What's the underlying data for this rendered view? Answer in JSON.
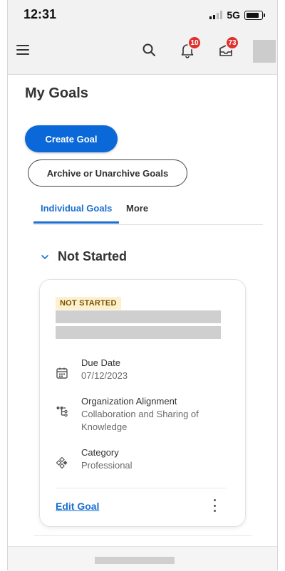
{
  "status_bar": {
    "time": "12:31",
    "network": "5G"
  },
  "header": {
    "menu_icon": "hamburger-icon",
    "search_icon": "search-icon",
    "notifications": {
      "icon": "bell-icon",
      "count": "10"
    },
    "inbox": {
      "icon": "inbox-icon",
      "count": "73"
    }
  },
  "page": {
    "title": "My Goals",
    "create_button": "Create Goal",
    "archive_button": "Archive or Unarchive Goals"
  },
  "tabs": [
    {
      "label": "Individual Goals",
      "active": true
    },
    {
      "label": "More",
      "active": false
    }
  ],
  "section": {
    "title": "Not Started"
  },
  "goal_card": {
    "status": "NOT STARTED",
    "due_date": {
      "label": "Due Date",
      "value": "07/12/2023"
    },
    "alignment": {
      "label": "Organization Alignment",
      "value": "Collaboration and Sharing of Knowledge"
    },
    "category": {
      "label": "Category",
      "value": "Professional"
    },
    "edit_link": "Edit Goal"
  },
  "colors": {
    "primary": "#0b68d8",
    "badge": "#e0312d",
    "status_pill_bg": "#fdf0cf"
  }
}
